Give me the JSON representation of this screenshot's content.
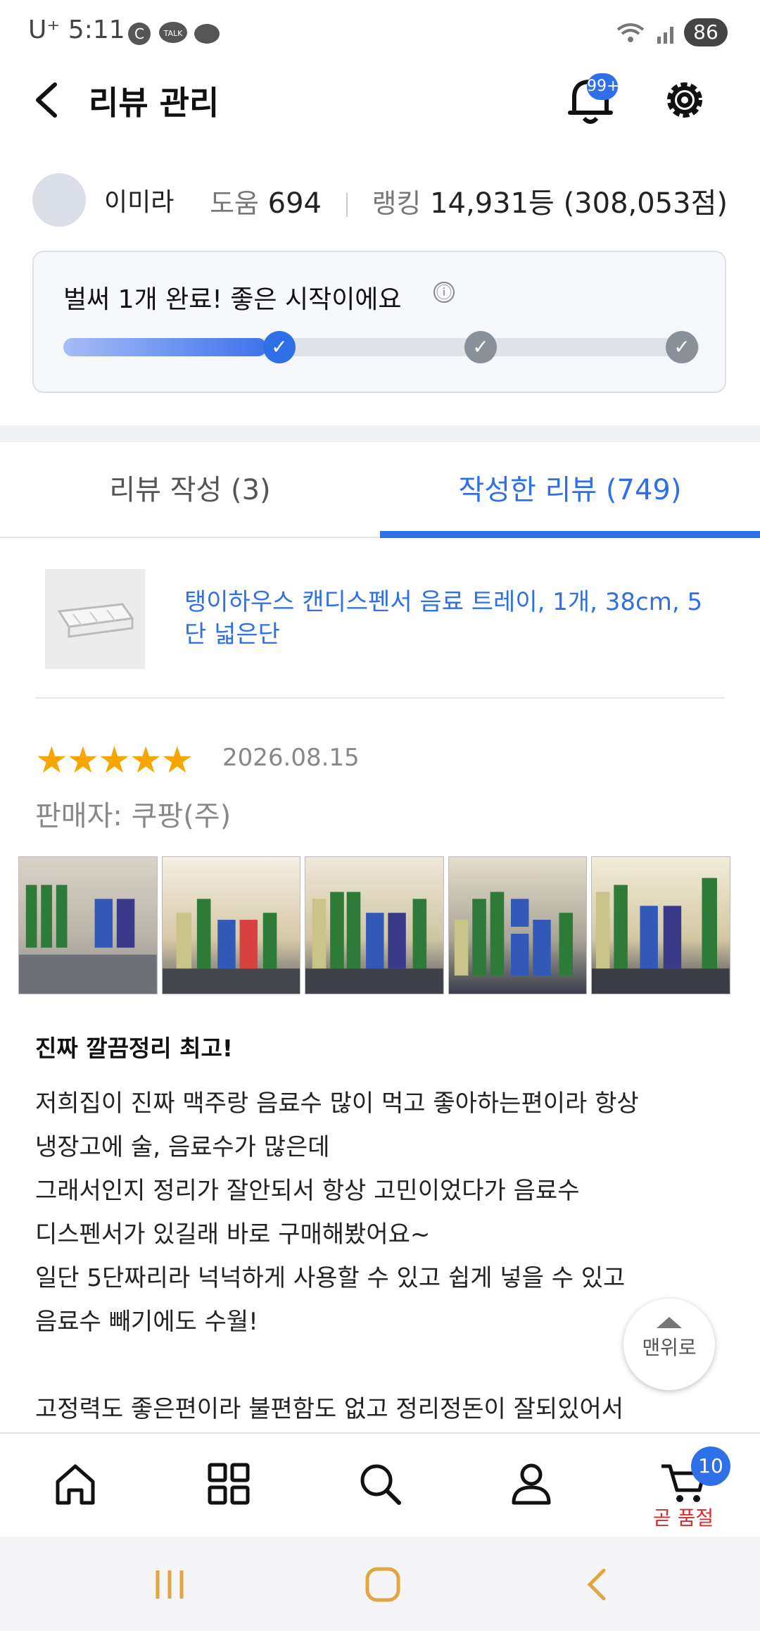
{
  "status_bar": {
    "time": "U⁺ 5:11",
    "battery": "86"
  },
  "header": {
    "title": "리뷰 관리",
    "notification_badge": "99+"
  },
  "profile": {
    "name": "이미라",
    "help_label": "도움",
    "help_value": "694",
    "rank_label": "랭킹",
    "rank_value": "14,931등 (308,053점)"
  },
  "progress_card": {
    "title": "벌써 1개 완료! 좋은 시작이에요",
    "info_icon": "ⓘ",
    "fill_fraction": 0.32,
    "completed_steps": 1,
    "total_steps": 3
  },
  "tabs": [
    {
      "label": "리뷰 작성 (3)",
      "active": false
    },
    {
      "label": "작성한 리뷰 (749)",
      "active": true
    }
  ],
  "product": {
    "name": "탱이하우스 캔디스펜서 음료 트레이, 1개, 38cm, 5단 넓은단"
  },
  "review": {
    "rating": 5,
    "stars": "★★★★★",
    "date": "2026.08.15",
    "seller": "판매자: 쿠팡(주)",
    "title": "진짜 깔끔정리 최고!",
    "body_lines": [
      "저희집이 진짜 맥주랑 음료수 많이 먹고 좋아하는편이라 항상",
      "냉장고에 술, 음료수가 많은데",
      "그래서인지 정리가 잘안되서 항상 고민이었다가 음료수",
      "디스펜서가 있길래 바로 구매해봤어요~",
      "일단 5단짜리라 넉넉하게 사용할 수 있고 쉽게 넣을 수 있고",
      "음료수 빼기에도 수월!",
      "",
      "고정력도 좋은편이라 불편함도 없고 정리정돈이 잘되있어서"
    ]
  },
  "top_button": {
    "label": "맨위로"
  },
  "bottom_nav": {
    "cart_badge": "10",
    "cart_label": "곧 품절"
  },
  "colors": {
    "accent": "#2f6fe8",
    "star": "#f7a600",
    "warning": "#d62d2d"
  }
}
